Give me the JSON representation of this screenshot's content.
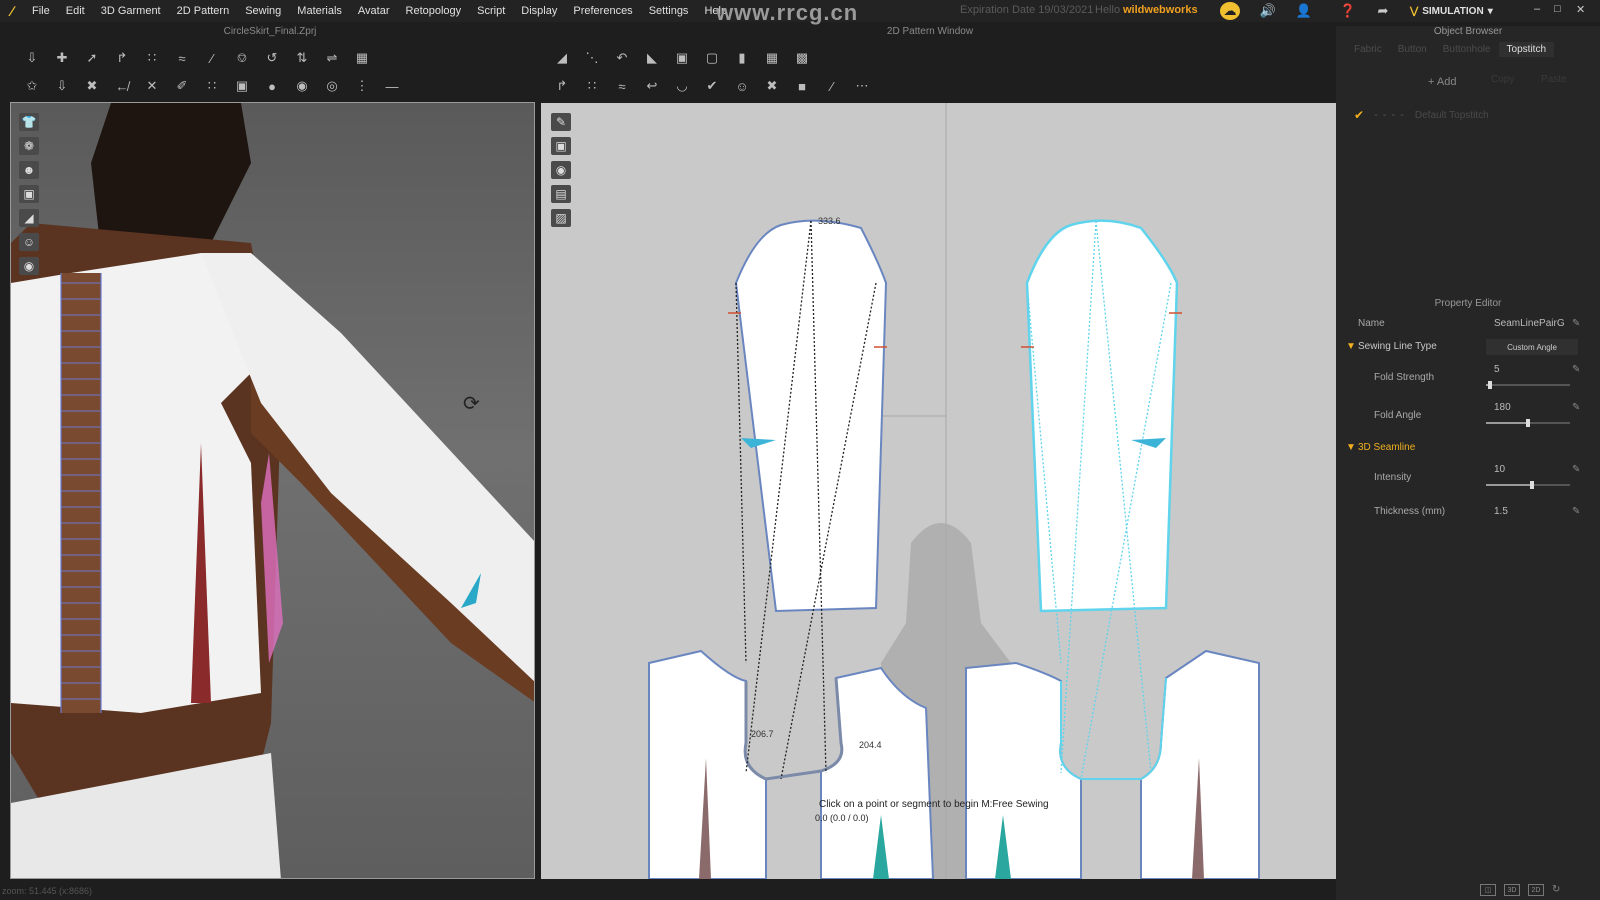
{
  "menu": {
    "logo": "∕",
    "items": [
      "File",
      "Edit",
      "3D Garment",
      "2D Pattern",
      "Sewing",
      "Materials",
      "Avatar",
      "Retopology",
      "Script",
      "Display",
      "Preferences",
      "Settings",
      "Help"
    ]
  },
  "header": {
    "watermark_url": "www.rrcg.cn",
    "expiration": "Expiration Date 19/03/2021",
    "hello": "Hello",
    "username": "wildwebworks",
    "mode": "SIMULATION",
    "window_buttons": [
      "–",
      "□",
      "✕"
    ]
  },
  "panel_3d": {
    "title": "CircleSkirt_Final.Zprj",
    "status": "zoom: 51.445 (x:8686)"
  },
  "panel_2d": {
    "title": "2D Pattern Window",
    "measure_top": "333.6",
    "measure_left": "206.7",
    "measure_right": "204.4",
    "hint": "Click on a point or segment to begin M:Free Sewing",
    "coords": "0.0 (0.0 / 0.0)"
  },
  "object_browser": {
    "title": "Object Browser",
    "tabs": [
      "Fabric",
      "Button",
      "Buttonhole",
      "Topstitch"
    ],
    "add_label": "+ Add",
    "copy_label": "Copy",
    "paste_label": "Paste",
    "default_item": "Default Topstitch"
  },
  "property_editor": {
    "title": "Property Editor",
    "name_label": "Name",
    "name_value": "SeamLinePairG",
    "sewing_line_type_label": "Sewing Line Type",
    "sewing_line_type_value": "Custom Angle",
    "fold_strength_label": "Fold Strength",
    "fold_strength_value": "5",
    "fold_strength_level": 0.05,
    "fold_angle_label": "Fold Angle",
    "fold_angle_value": "180",
    "fold_angle_level": 0.5,
    "seamline_label": "3D Seamline",
    "intensity_label": "Intensity",
    "intensity_value": "10",
    "intensity_level": 0.55,
    "thickness_label": "Thickness (mm)",
    "thickness_value": "1.5"
  },
  "icons": {
    "cloud": "cloud-icon",
    "sound": "speaker-icon",
    "user": "user-icon",
    "help": "help-icon",
    "share": "share-icon"
  }
}
